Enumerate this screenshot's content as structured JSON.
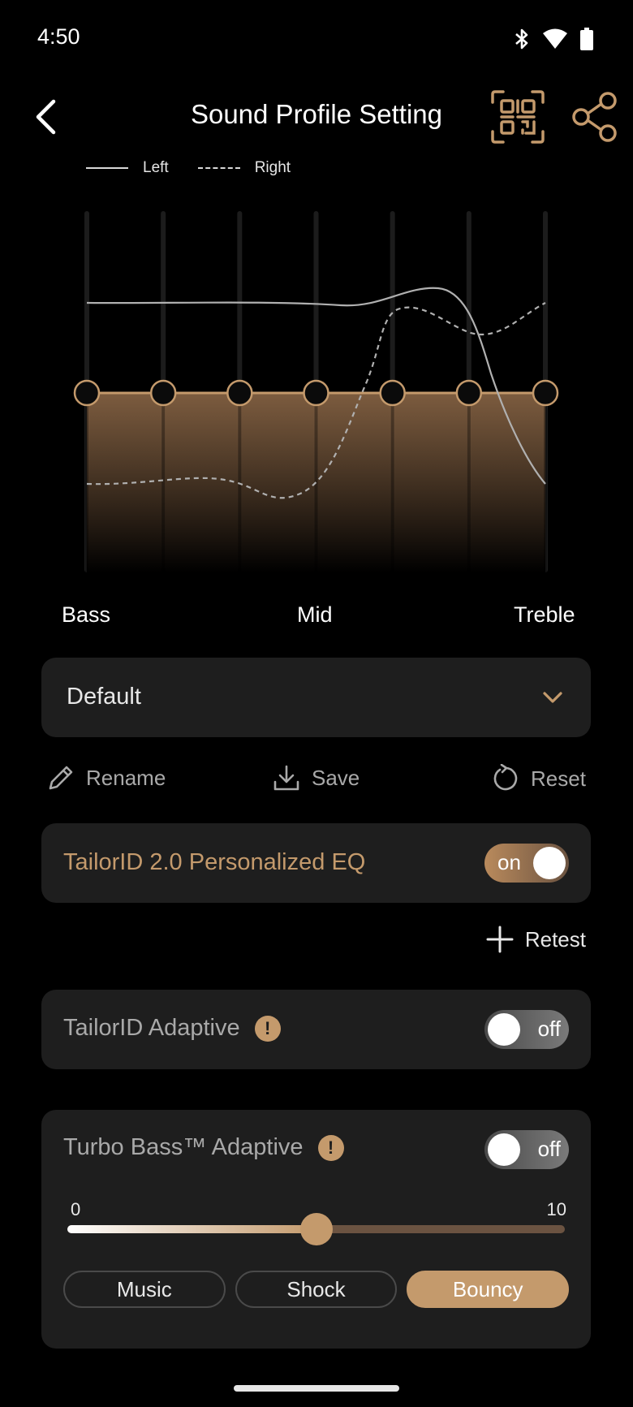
{
  "status_bar": {
    "time": "4:50",
    "icons": [
      "bluetooth-icon",
      "wifi-icon",
      "battery-icon"
    ]
  },
  "header": {
    "title": "Sound Profile Setting",
    "back_icon": "chevron-left-icon",
    "qr_icon": "qr-code-icon",
    "share_icon": "share-icon"
  },
  "legend": {
    "left_label": "Left",
    "right_label": "Right"
  },
  "eq": {
    "band_count": 7,
    "band_levels": [
      0,
      0,
      0,
      0,
      0,
      0,
      0
    ],
    "labels": {
      "low": "Bass",
      "mid": "Mid",
      "high": "Treble"
    }
  },
  "colors": {
    "accent": "#c49a6c",
    "card_bg": "#1e1e1e",
    "background": "#000000",
    "muted_text": "#a9a9a9"
  },
  "preset": {
    "value": "Default",
    "chevron_icon": "chevron-down-icon"
  },
  "actions": {
    "rename": "Rename",
    "save": "Save",
    "reset": "Reset"
  },
  "tailorid_eq": {
    "label": "TailorID 2.0 Personalized EQ",
    "toggle_text": "on"
  },
  "retest": {
    "label": "Retest"
  },
  "tailorid_adaptive": {
    "label": "TailorID Adaptive",
    "info": "!",
    "toggle_text": "off"
  },
  "turbo_bass": {
    "label": "Turbo Bass™ Adaptive",
    "info": "!",
    "toggle_text": "off",
    "slider": {
      "min_label": "0",
      "max_label": "10",
      "value_fraction": 0.5
    },
    "modes": [
      "Music",
      "Shock",
      "Bouncy"
    ],
    "selected_mode": "Bouncy"
  }
}
